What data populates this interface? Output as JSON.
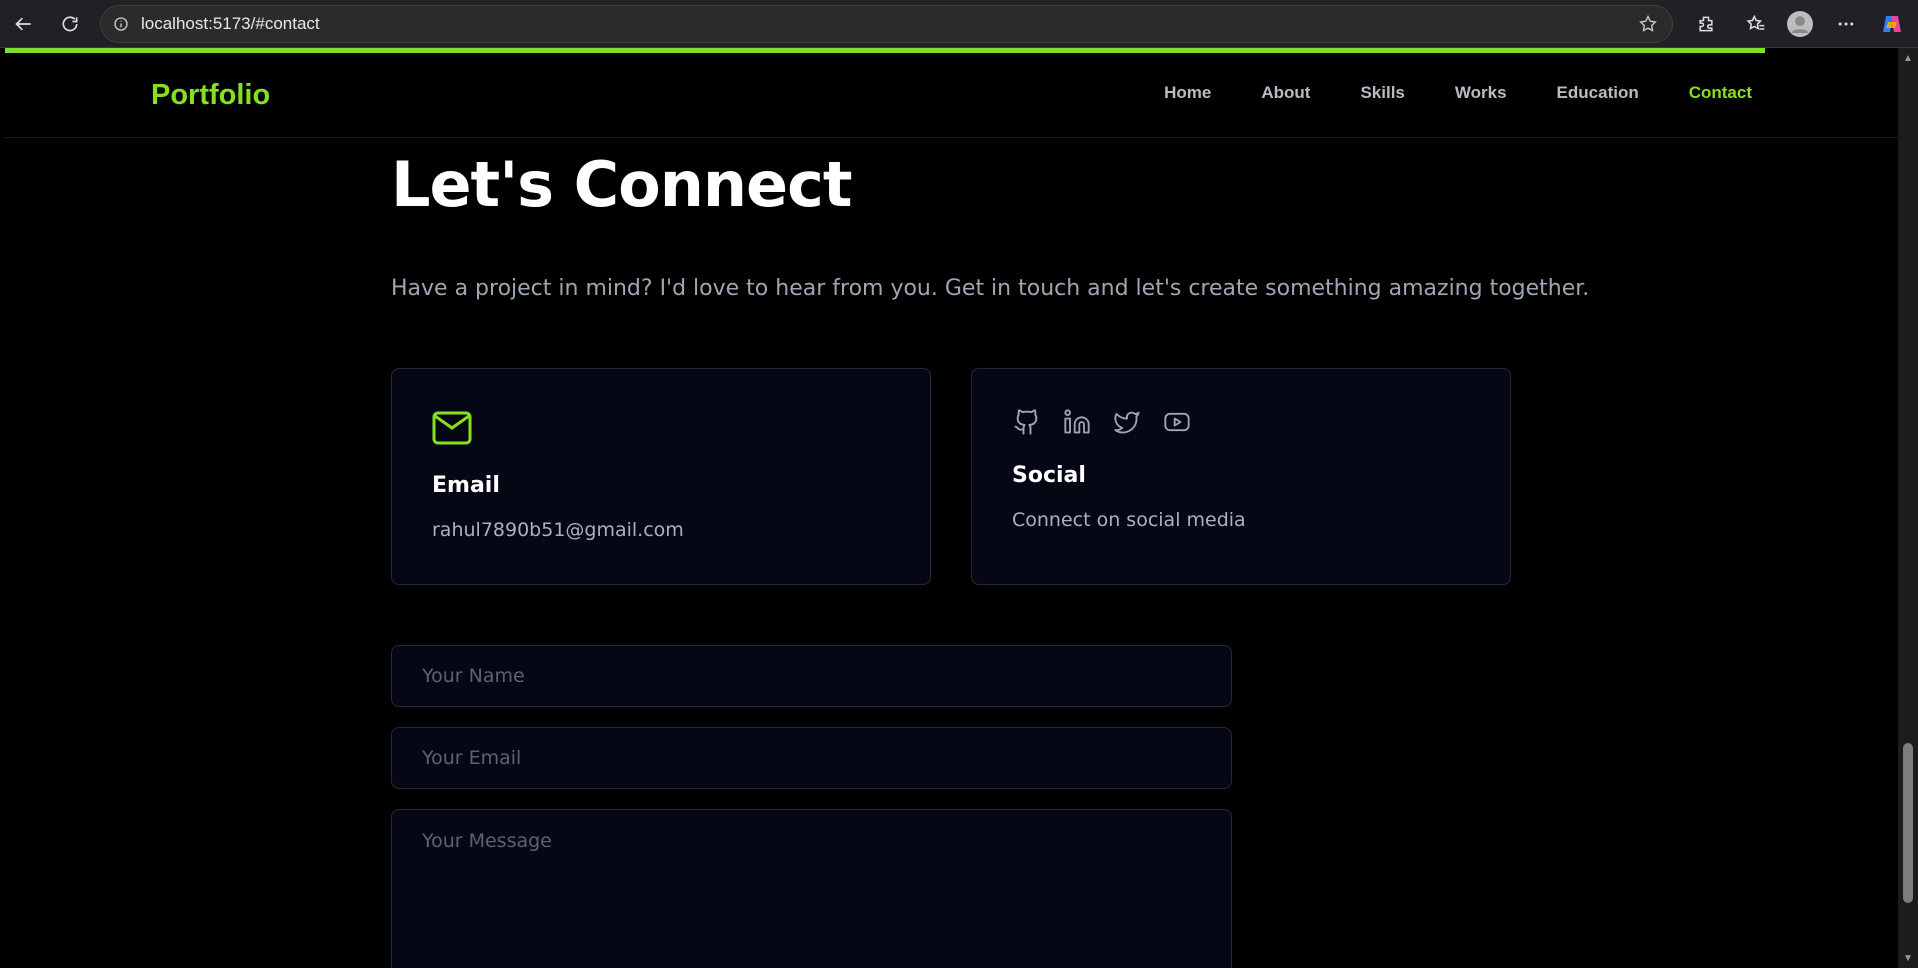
{
  "browser": {
    "url": "localhost:5173/#contact"
  },
  "progress": {
    "scroll_fraction": 0.93
  },
  "site": {
    "logo": "Portfolio",
    "nav": [
      {
        "label": "Home",
        "active": false
      },
      {
        "label": "About",
        "active": false
      },
      {
        "label": "Skills",
        "active": false
      },
      {
        "label": "Works",
        "active": false
      },
      {
        "label": "Education",
        "active": false
      },
      {
        "label": "Contact",
        "active": true
      }
    ]
  },
  "contact": {
    "title": "Let's Connect",
    "subtitle": "Have a project in mind? I'd love to hear from you. Get in touch and let's create something amazing together.",
    "email_card": {
      "title": "Email",
      "value": "rahul7890b51@gmail.com",
      "icon": "mail-icon"
    },
    "social_card": {
      "title": "Social",
      "text": "Connect on social media",
      "icons": [
        "github-icon",
        "linkedin-icon",
        "twitter-icon",
        "youtube-icon"
      ]
    },
    "form": {
      "name_placeholder": "Your Name",
      "email_placeholder": "Your Email",
      "message_placeholder": "Your Message"
    }
  },
  "colors": {
    "accent": "#86e01f",
    "background": "#000000",
    "card": "#050814"
  }
}
